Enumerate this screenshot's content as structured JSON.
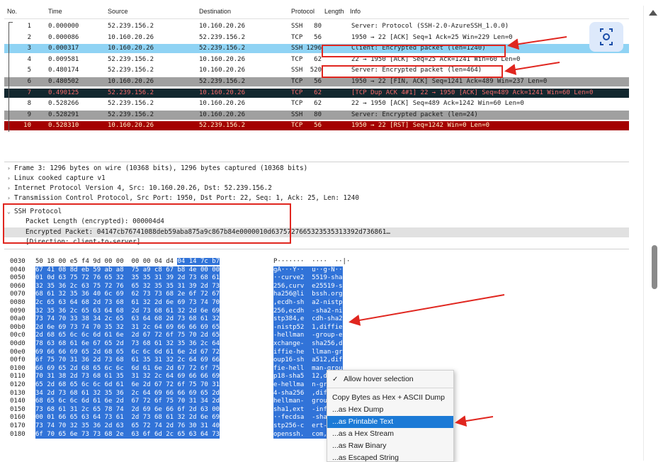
{
  "packet_list": {
    "columns": [
      "No.",
      "Time",
      "Source",
      "Destination",
      "Protocol",
      "Length",
      "Info"
    ],
    "rows": [
      {
        "no": "1",
        "time": "0.000000",
        "src": "52.239.156.2",
        "dst": "10.160.20.26",
        "proto": "SSH",
        "len": "80",
        "info": "Server: Protocol (SSH-2.0-AzureSSH_1.0.0)"
      },
      {
        "no": "2",
        "time": "0.000086",
        "src": "10.160.20.26",
        "dst": "52.239.156.2",
        "proto": "TCP",
        "len": "56",
        "info": "1950 → 22 [ACK] Seq=1 Ack=25 Win=229 Len=0"
      },
      {
        "no": "3",
        "time": "0.000317",
        "src": "10.160.20.26",
        "dst": "52.239.156.2",
        "proto": "SSH",
        "len": "1296",
        "info": "Client: Encrypted packet (len=1240)"
      },
      {
        "no": "4",
        "time": "0.009581",
        "src": "52.239.156.2",
        "dst": "10.160.20.26",
        "proto": "TCP",
        "len": "62",
        "info": "22 → 1950 [ACK] Seq=25 Ack=1241 Win=60 Len=0"
      },
      {
        "no": "5",
        "time": "0.480174",
        "src": "52.239.156.2",
        "dst": "10.160.20.26",
        "proto": "SSH",
        "len": "520",
        "info": "Server: Encrypted packet (len=464)"
      },
      {
        "no": "6",
        "time": "0.480502",
        "src": "10.160.20.26",
        "dst": "52.239.156.2",
        "proto": "TCP",
        "len": "56",
        "info": "1950 → 22 [FIN, ACK] Seq=1241 Ack=489 Win=237 Len=0"
      },
      {
        "no": "7",
        "time": "0.490125",
        "src": "52.239.156.2",
        "dst": "10.160.20.26",
        "proto": "TCP",
        "len": "62",
        "info": "[TCP Dup ACK 4#1] 22 → 1950 [ACK] Seq=489 Ack=1241 Win=60 Len=0"
      },
      {
        "no": "8",
        "time": "0.528266",
        "src": "52.239.156.2",
        "dst": "10.160.20.26",
        "proto": "TCP",
        "len": "62",
        "info": "22 → 1950 [ACK] Seq=489 Ack=1242 Win=60 Len=0"
      },
      {
        "no": "9",
        "time": "0.528291",
        "src": "52.239.156.2",
        "dst": "10.160.20.26",
        "proto": "SSH",
        "len": "80",
        "info": "Server: Encrypted packet (len=24)"
      },
      {
        "no": "10",
        "time": "0.528310",
        "src": "10.160.20.26",
        "dst": "52.239.156.2",
        "proto": "TCP",
        "len": "56",
        "info": "1950 → 22 [RST] Seq=1242 Win=0 Len=0"
      }
    ]
  },
  "details": {
    "lines": [
      "Frame 3: 1296 bytes on wire (10368 bits), 1296 bytes captured (10368 bits)",
      "Linux cooked capture v1",
      "Internet Protocol Version 4, Src: 10.160.20.26, Dst: 52.239.156.2",
      "Transmission Control Protocol, Src Port: 1950, Dst Port: 22, Seq: 1, Ack: 25, Len: 1240",
      "SSH Protocol",
      "Packet Length (encrypted): 000004d4",
      "Encrypted Packet: 04147cb76741088deb59aba875a9c867b84e0000010d6375727665323535313392d736861…",
      "[Direction: client-to-server]"
    ]
  },
  "hex": {
    "rows": [
      {
        "off": "0030",
        "hex": "50 18 00 e5 f4 9d 00 00  00 00 04 d4 04 14 7c b7",
        "asc": "P·······  ····  ··|·"
      },
      {
        "off": "0040",
        "hex": "67 41 08 8d eb 59 ab a8  75 a9 c8 67 b8 4e 00 00",
        "asc": "gA···Y··  u··g·N··"
      },
      {
        "off": "0050",
        "hex": "01 0d 63 75 72 76 65 32  35 35 31 39 2d 73 68 61",
        "asc": "··curve2  5519-sha"
      },
      {
        "off": "0060",
        "hex": "32 35 36 2c 63 75 72 76  65 32 35 35 31 39 2d 73",
        "asc": "256,curv  e25519-s"
      },
      {
        "off": "0070",
        "hex": "68 61 32 35 36 40 6c 69  62 73 73 68 2e 6f 72 67",
        "asc": "ha256@li  bssh.org"
      },
      {
        "off": "0080",
        "hex": "2c 65 63 64 68 2d 73 68  61 32 2d 6e 69 73 74 70",
        "asc": ",ecdh-sh  a2-nistp"
      },
      {
        "off": "0090",
        "hex": "32 35 36 2c 65 63 64 68  2d 73 68 61 32 2d 6e 69",
        "asc": "256,ecdh  -sha2-ni"
      },
      {
        "off": "00a0",
        "hex": "73 74 70 33 38 34 2c 65  63 64 68 2d 73 68 61 32",
        "asc": "stp384,e  cdh-sha2"
      },
      {
        "off": "00b0",
        "hex": "2d 6e 69 73 74 70 35 32  31 2c 64 69 66 66 69 65",
        "asc": "-nistp52  1,diffie"
      },
      {
        "off": "00c0",
        "hex": "2d 68 65 6c 6c 6d 61 6e  2d 67 72 6f 75 70 2d 65",
        "asc": "-hellman  -group-e"
      },
      {
        "off": "00d0",
        "hex": "78 63 68 61 6e 67 65 2d  73 68 61 32 35 36 2c 64",
        "asc": "xchange-  sha256,d"
      },
      {
        "off": "00e0",
        "hex": "69 66 66 69 65 2d 68 65  6c 6c 6d 61 6e 2d 67 72",
        "asc": "iffie-he  llman-gr"
      },
      {
        "off": "00f0",
        "hex": "6f 75 70 31 36 2d 73 68  61 35 31 32 2c 64 69 66",
        "asc": "oup16-sh  a512,dif"
      },
      {
        "off": "0100",
        "hex": "66 69 65 2d 68 65 6c 6c  6d 61 6e 2d 67 72 6f 75",
        "asc": "fie-hell  man-grou"
      },
      {
        "off": "0110",
        "hex": "70 31 38 2d 73 68 61 35  31 32 2c 64 69 66 66 69",
        "asc": "p18-sha5  12,diffi"
      },
      {
        "off": "0120",
        "hex": "65 2d 68 65 6c 6c 6d 61  6e 2d 67 72 6f 75 70 31",
        "asc": "e-hellma  n-group1"
      },
      {
        "off": "0130",
        "hex": "34 2d 73 68 61 32 35 36  2c 64 69 66 66 69 65 2d",
        "asc": "4-sha256  ,diffie-"
      },
      {
        "off": "0140",
        "hex": "68 65 6c 6c 6d 61 6e 2d  67 72 6f 75 70 31 34 2d",
        "asc": "hellman-  group14-"
      },
      {
        "off": "0150",
        "hex": "73 68 61 31 2c 65 78 74  2d 69 6e 66 6f 2d 63 00",
        "asc": "sha1,ext  -info-c·"
      },
      {
        "off": "0160",
        "hex": "00 01 66 65 63 64 73 61  2d 73 68 61 32 2d 6e 69",
        "asc": "··fecdsa  -sha2-ni"
      },
      {
        "off": "0170",
        "hex": "73 74 70 32 35 36 2d 63  65 72 74 2d 76 30 31 40",
        "asc": "stp256-c  ert-v01@"
      },
      {
        "off": "0180",
        "hex": "6f 70 65 6e 73 73 68 2e  63 6f 6d 2c 65 63 64 73",
        "asc": "openssh.  com,ecds"
      }
    ]
  },
  "context_menu": {
    "items": [
      {
        "label": "Allow hover selection",
        "checked": true
      },
      {
        "label": "Copy Bytes as Hex + ASCII Dump"
      },
      {
        "label": "...as Hex Dump"
      },
      {
        "label": "...as Printable Text",
        "highlighted": true
      },
      {
        "label": "...as a Hex Stream"
      },
      {
        "label": "...as Raw Binary"
      },
      {
        "label": "...as Escaped String"
      }
    ]
  },
  "colors": {
    "annotation_red": "#e0261f",
    "selected_blue": "#3173d8",
    "row_gray": "#a0a0a0",
    "row_black": "#12272e",
    "row_red": "#a40000",
    "menu_highlight": "#1c7ad6"
  }
}
